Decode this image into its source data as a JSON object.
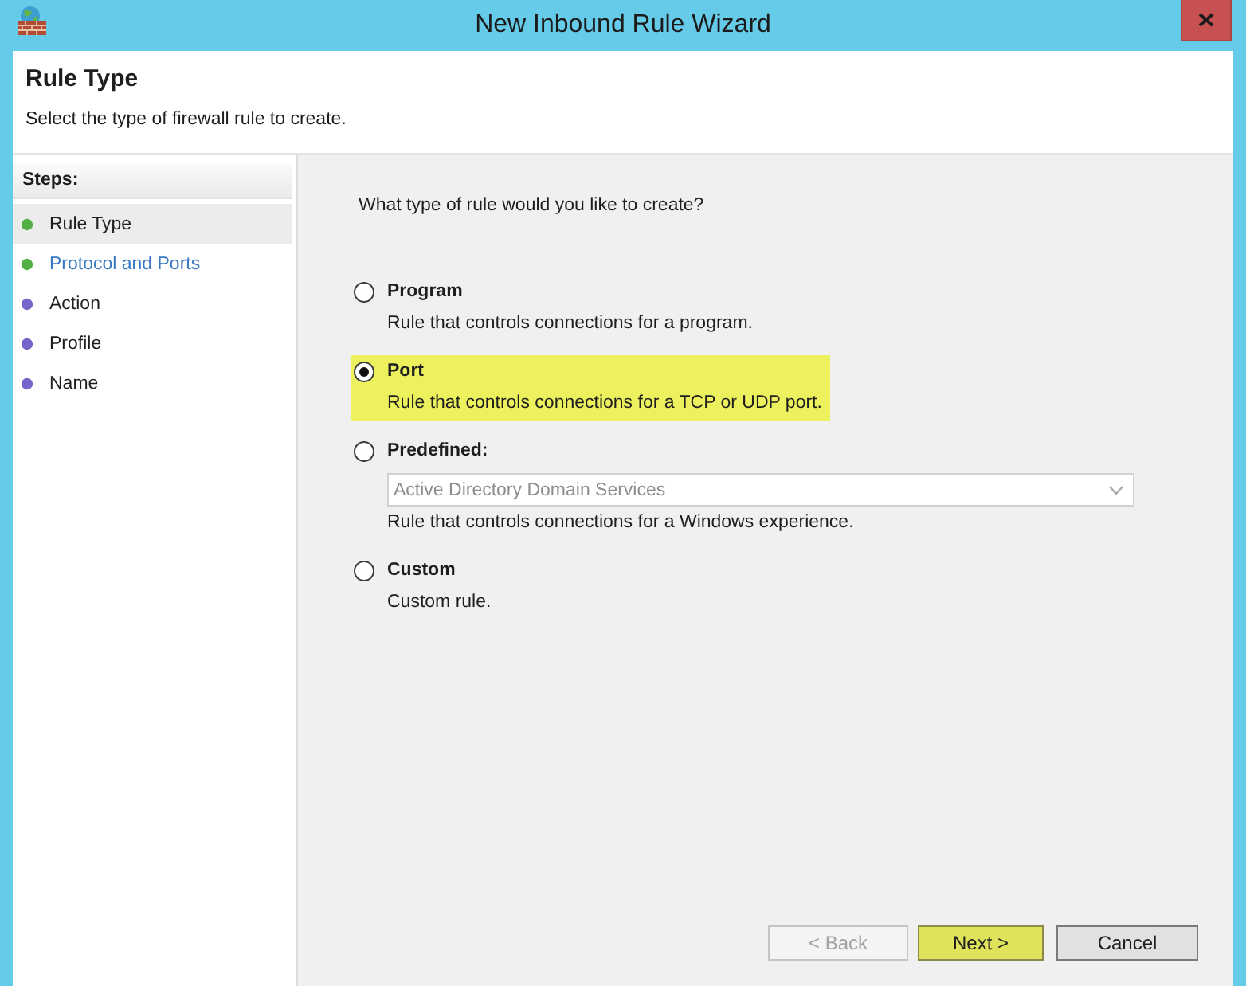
{
  "window": {
    "title": "New Inbound Rule Wizard"
  },
  "header": {
    "title": "Rule Type",
    "subtitle": "Select the type of firewall rule to create."
  },
  "steps": {
    "heading": "Steps:",
    "items": [
      {
        "label": "Rule Type",
        "selected": true,
        "hovered": false,
        "color": "#52b043"
      },
      {
        "label": "Protocol and Ports",
        "selected": false,
        "hovered": true,
        "color": "#52b043"
      },
      {
        "label": "Action",
        "selected": false,
        "hovered": false,
        "color": "#7467c9"
      },
      {
        "label": "Profile",
        "selected": false,
        "hovered": false,
        "color": "#7467c9"
      },
      {
        "label": "Name",
        "selected": false,
        "hovered": false,
        "color": "#7467c9"
      }
    ]
  },
  "question": "What type of rule would you like to create?",
  "options": [
    {
      "label": "Program",
      "description": "Rule that controls connections for a program.",
      "selected": false,
      "highlighted": false
    },
    {
      "label": "Port",
      "description": "Rule that controls connections for a TCP or UDP port.",
      "selected": true,
      "highlighted": true
    },
    {
      "label": "Predefined:",
      "dropdown": {
        "value": "Active Directory Domain Services",
        "disabled": true
      },
      "description": "Rule that controls connections for a Windows experience.",
      "selected": false,
      "highlighted": false
    },
    {
      "label": "Custom",
      "description": "Custom rule.",
      "selected": false,
      "highlighted": false
    }
  ],
  "buttons": [
    {
      "label": "< Back",
      "disabled": true,
      "highlighted": false
    },
    {
      "label": "Next >",
      "disabled": false,
      "highlighted": true
    },
    {
      "label": "Cancel",
      "disabled": false,
      "highlighted": false
    }
  ]
}
